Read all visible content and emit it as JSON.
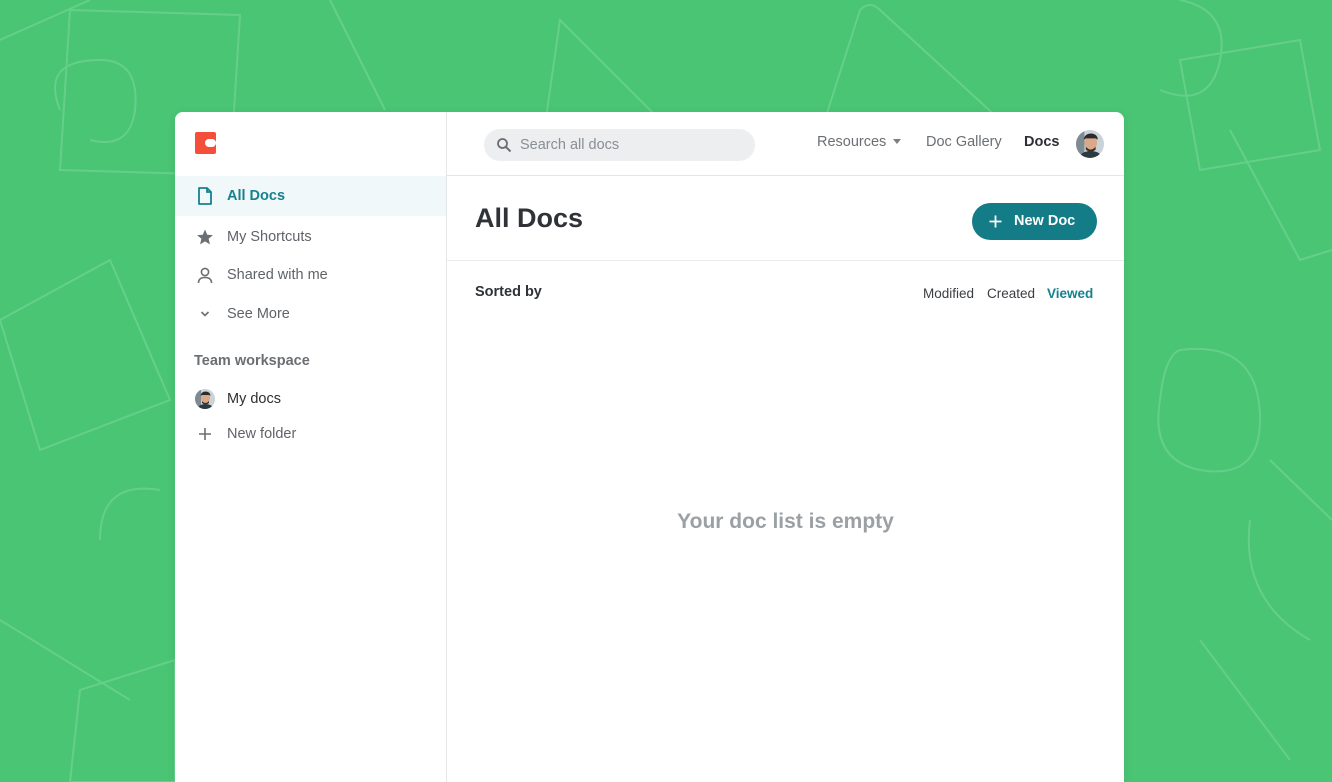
{
  "colors": {
    "background": "#4ac574",
    "accent": "#17818f",
    "primary_button": "#147c86",
    "logo": "#f44f3a"
  },
  "sidebar": {
    "logo_icon": "coda-logo",
    "items": [
      {
        "label": "All Docs",
        "icon": "document-icon",
        "active": true
      },
      {
        "label": "My Shortcuts",
        "icon": "star-icon"
      },
      {
        "label": "Shared with me",
        "icon": "person-icon"
      },
      {
        "label": "See More",
        "icon": "chevron-down-icon"
      }
    ],
    "section_title": "Team workspace",
    "workspace_items": [
      {
        "label": "My docs",
        "icon": "avatar"
      },
      {
        "label": "New folder",
        "icon": "plus-icon"
      }
    ]
  },
  "topbar": {
    "search_placeholder": "Search all docs",
    "links": [
      {
        "label": "Resources",
        "has_dropdown": true
      },
      {
        "label": "Doc Gallery"
      },
      {
        "label": "Docs",
        "active": true
      }
    ]
  },
  "main": {
    "title": "All Docs",
    "new_doc_label": "New Doc",
    "sorted_by_label": "Sorted by",
    "sort_options": [
      {
        "label": "Modified"
      },
      {
        "label": "Created"
      },
      {
        "label": "Viewed",
        "active": true
      }
    ],
    "empty_message": "Your doc list is empty"
  }
}
